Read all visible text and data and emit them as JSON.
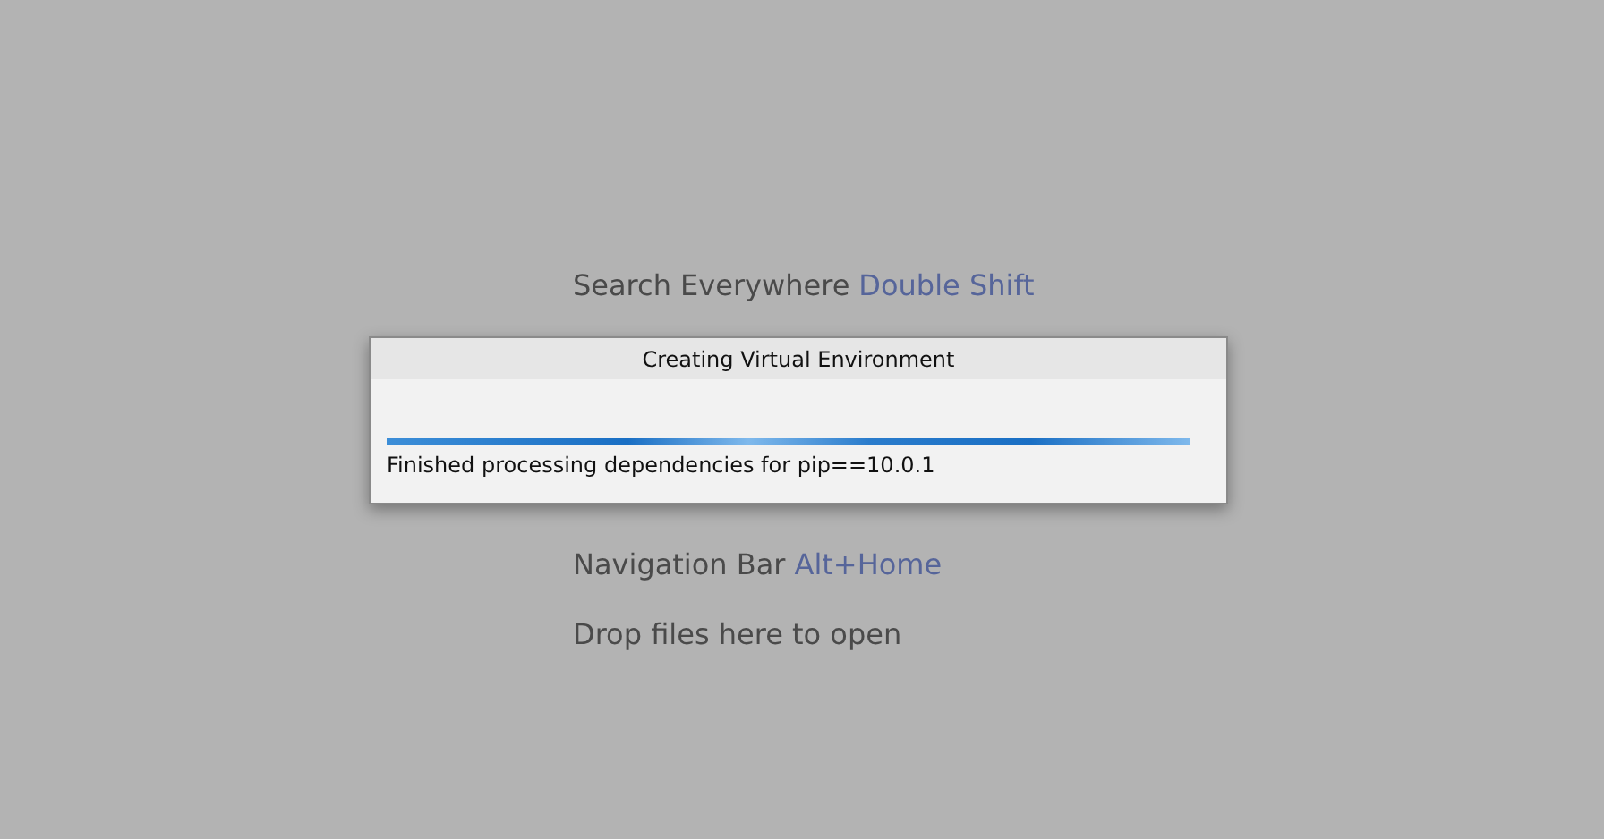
{
  "hints": [
    {
      "label": "Search Everywhere",
      "shortcut": "Double Shift"
    },
    {
      "label": "Navigation Bar",
      "shortcut": "Alt+Home"
    },
    {
      "label": "Drop files here to open"
    }
  ],
  "dialog": {
    "title": "Creating Virtual Environment",
    "progress": {
      "level": 1
    },
    "status": "Finished processing dependencies for pip==10.0.1"
  }
}
